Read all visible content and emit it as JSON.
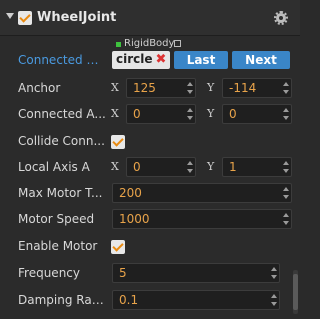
{
  "header": {
    "title": "WheelJoint",
    "enabled": true
  },
  "connected_body": {
    "label": "Connected B...",
    "component_type": "RigidBody",
    "node_name": "circle",
    "last_label": "Last",
    "next_label": "Next"
  },
  "anchor": {
    "label": "Anchor",
    "x_axis": "X",
    "y_axis": "Y",
    "x": "125",
    "y": "-114"
  },
  "connected_anchor": {
    "label": "Connected A...",
    "x_axis": "X",
    "y_axis": "Y",
    "x": "0",
    "y": "0"
  },
  "collide_connected": {
    "label": "Collide Conn...",
    "checked": true
  },
  "local_axis": {
    "label": "Local Axis A",
    "x_axis": "X",
    "y_axis": "Y",
    "x": "0",
    "y": "1"
  },
  "max_motor_torque": {
    "label": "Max Motor T...",
    "value": "200"
  },
  "motor_speed": {
    "label": "Motor Speed",
    "value": "1000"
  },
  "enable_motor": {
    "label": "Enable Motor",
    "checked": true
  },
  "frequency": {
    "label": "Frequency",
    "value": "5"
  },
  "damping_ratio": {
    "label": "Damping Ratio",
    "value": "0.1"
  },
  "colors": {
    "accent_orange": "#e8a34a",
    "check_orange": "#e98b12",
    "button_blue": "#3a86c8",
    "label_blue": "#4a9ae0"
  }
}
